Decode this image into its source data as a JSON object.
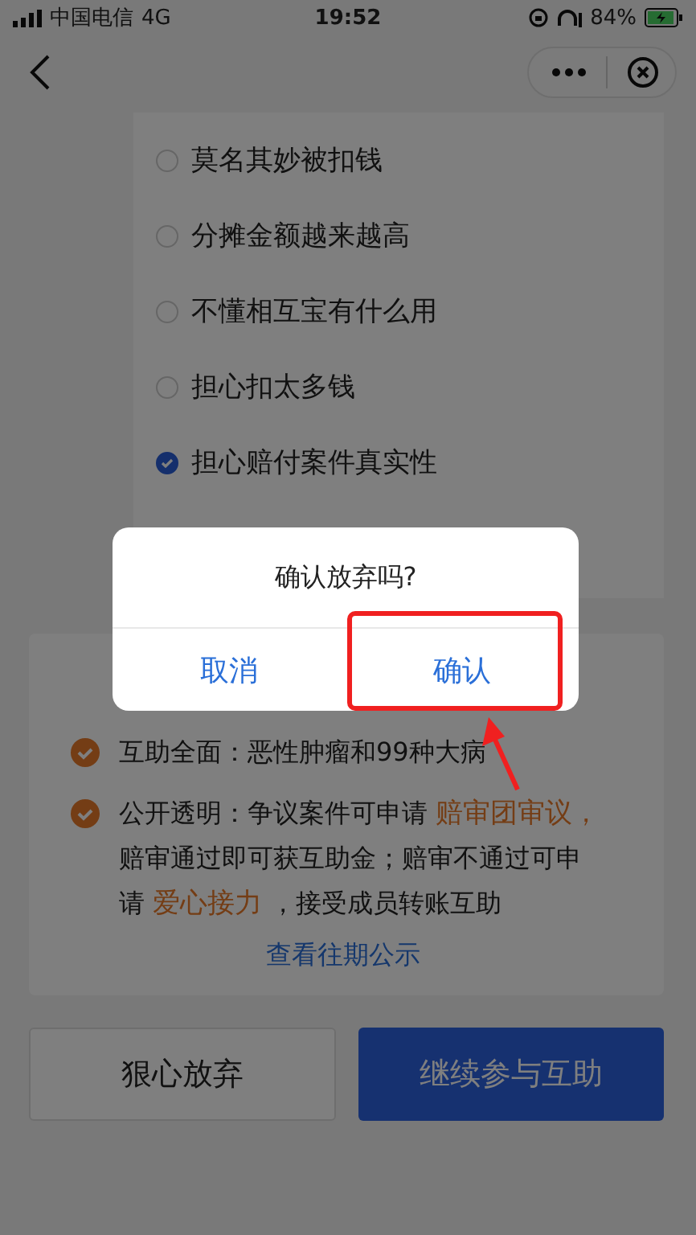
{
  "status_bar": {
    "carrier": "中国电信",
    "network": "4G",
    "time": "19:52",
    "battery": "84%"
  },
  "reasons": [
    {
      "label": "莫名其妙被扣钱",
      "checked": false
    },
    {
      "label": "分摊金额越来越高",
      "checked": false
    },
    {
      "label": "不懂相互宝有什么用",
      "checked": false
    },
    {
      "label": "担心扣太多钱",
      "checked": false
    },
    {
      "label": "担心赔付案件真实性",
      "checked": true
    }
  ],
  "benefits": [
    {
      "parts": [
        {
          "text": "互助全面：恶性肿瘤和99种大病",
          "highlight": false
        }
      ]
    },
    {
      "parts": [
        {
          "text": "公开透明：争议案件可申请 ",
          "highlight": false
        },
        {
          "text": "赔审团审议，",
          "highlight": true
        },
        {
          "text": "赔审通过即可获互助金；赔审不通过可申请 ",
          "highlight": false
        },
        {
          "text": "爱心接力",
          "highlight": true
        },
        {
          "text": " ，接受成员转账互助",
          "highlight": false
        }
      ]
    }
  ],
  "link": "查看往期公示",
  "buttons": [
    {
      "label": "狠心放弃",
      "kind": "secondary"
    },
    {
      "label": "继续参与互助",
      "kind": "primary"
    }
  ],
  "dialog": {
    "message": "确认放弃吗?",
    "buttons": [
      {
        "label": "取消"
      },
      {
        "label": "确认"
      }
    ]
  }
}
